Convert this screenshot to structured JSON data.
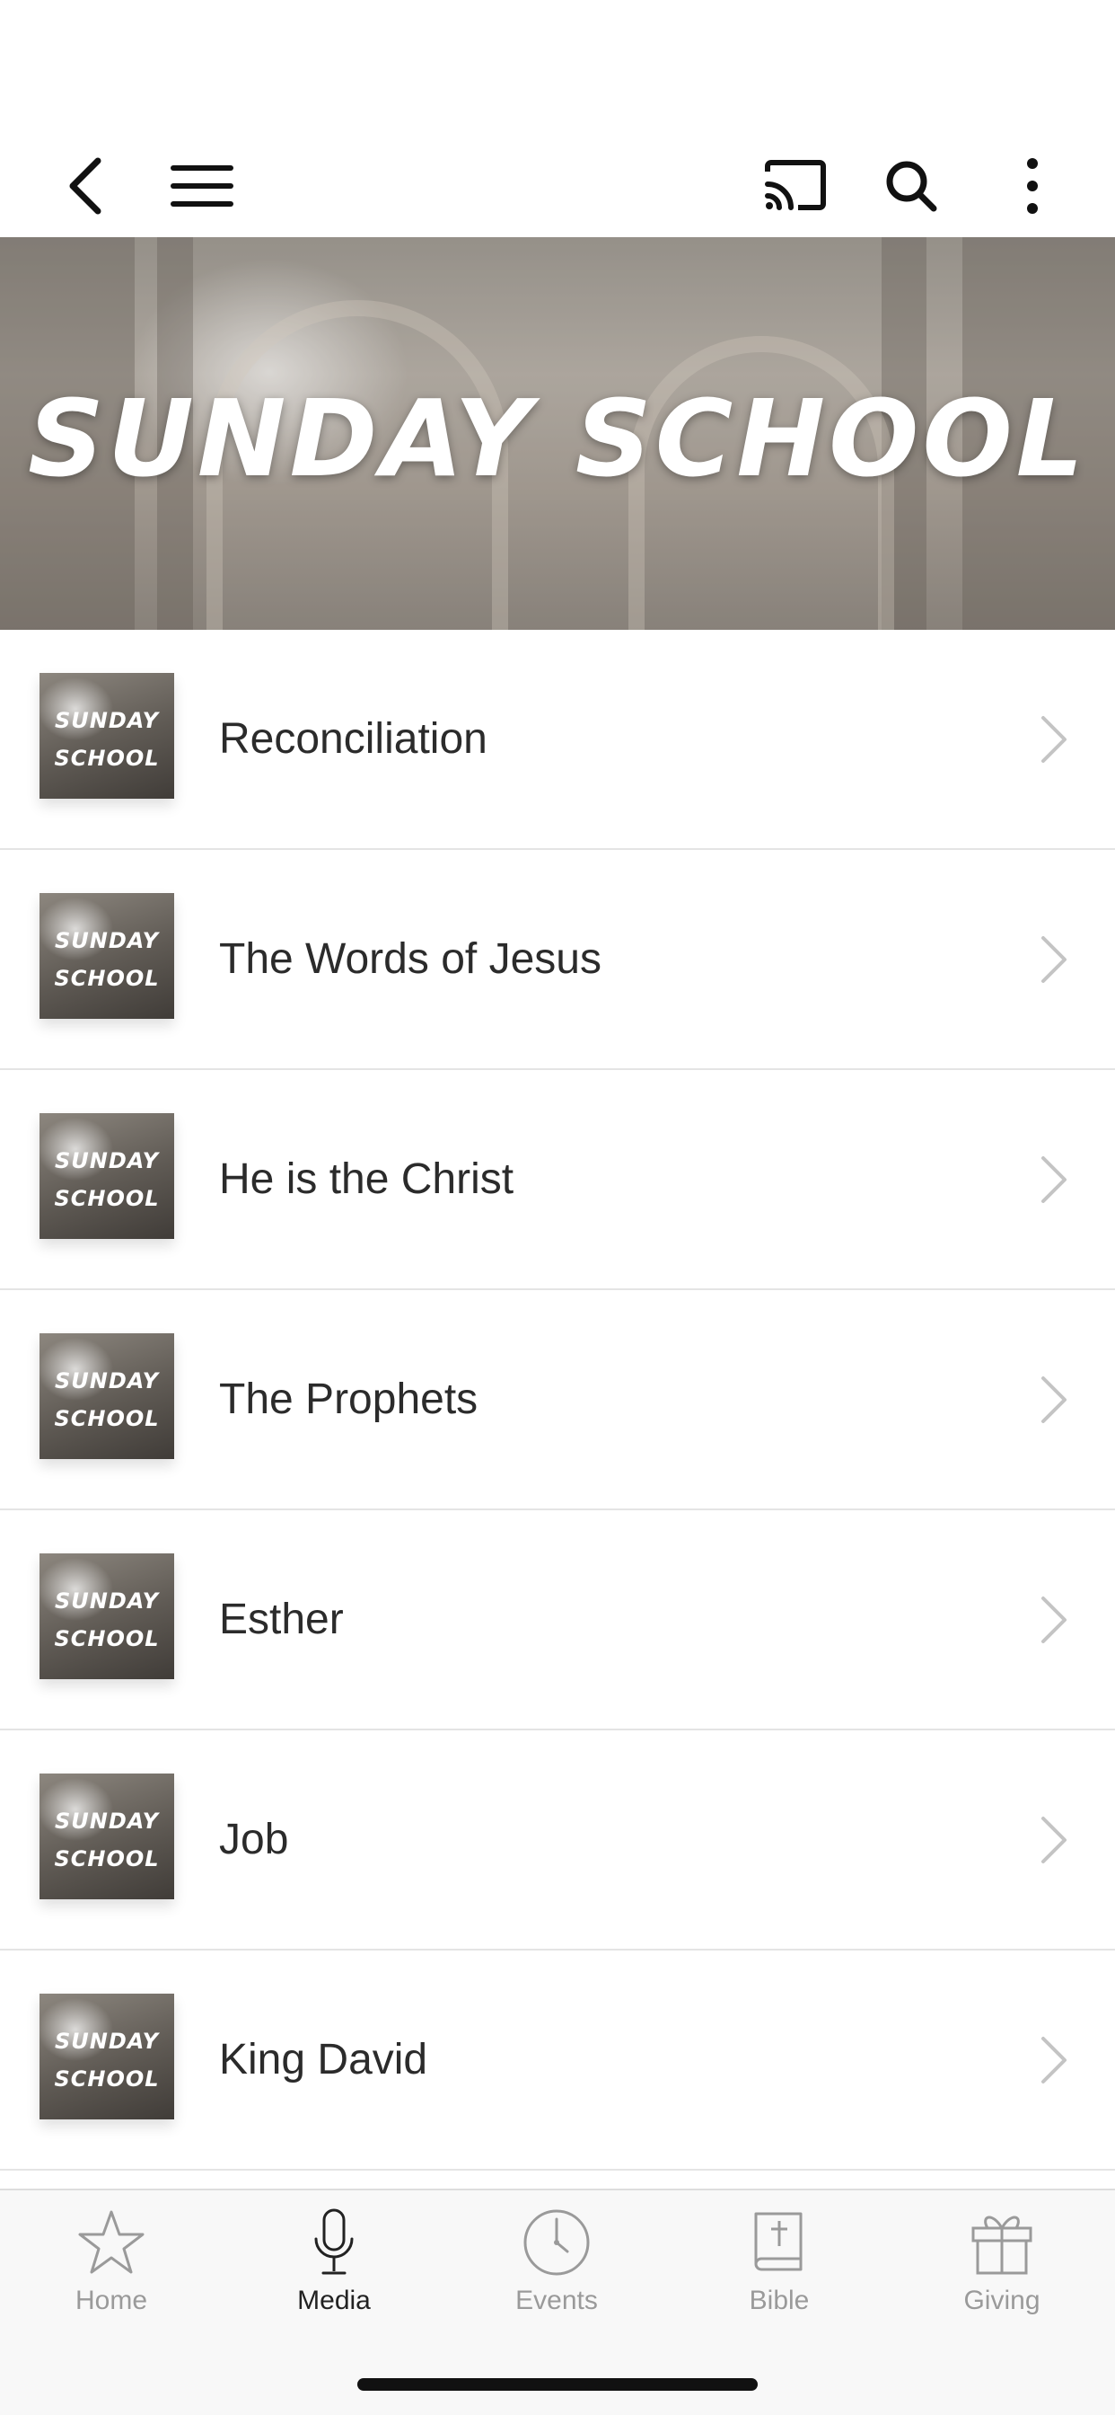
{
  "header": {
    "back_icon": "chevron-left-icon",
    "menu_icon": "hamburger-menu-icon",
    "cast_icon": "cast-icon",
    "search_icon": "search-icon",
    "more_icon": "more-vertical-icon"
  },
  "banner": {
    "title": "SUNDAY SCHOOL"
  },
  "series": [
    {
      "title": "Reconciliation",
      "thumb_line1": "SUNDAY",
      "thumb_line2": "SCHOOL"
    },
    {
      "title": "The Words of Jesus",
      "thumb_line1": "SUNDAY",
      "thumb_line2": "SCHOOL"
    },
    {
      "title": "He is the Christ",
      "thumb_line1": "SUNDAY",
      "thumb_line2": "SCHOOL"
    },
    {
      "title": "The Prophets",
      "thumb_line1": "SUNDAY",
      "thumb_line2": "SCHOOL"
    },
    {
      "title": "Esther",
      "thumb_line1": "SUNDAY",
      "thumb_line2": "SCHOOL"
    },
    {
      "title": "Job",
      "thumb_line1": "SUNDAY",
      "thumb_line2": "SCHOOL"
    },
    {
      "title": "King David",
      "thumb_line1": "SUNDAY",
      "thumb_line2": "SCHOOL"
    }
  ],
  "tabs": [
    {
      "label": "Home",
      "icon": "star-icon",
      "active": false
    },
    {
      "label": "Media",
      "icon": "microphone-icon",
      "active": true
    },
    {
      "label": "Events",
      "icon": "clock-icon",
      "active": false
    },
    {
      "label": "Bible",
      "icon": "bible-icon",
      "active": false
    },
    {
      "label": "Giving",
      "icon": "gift-icon",
      "active": false
    }
  ],
  "colors": {
    "text_primary": "#2b2b2b",
    "tab_inactive": "#9a9a9a",
    "tab_active": "#222222",
    "divider": "#e4e4e4"
  }
}
